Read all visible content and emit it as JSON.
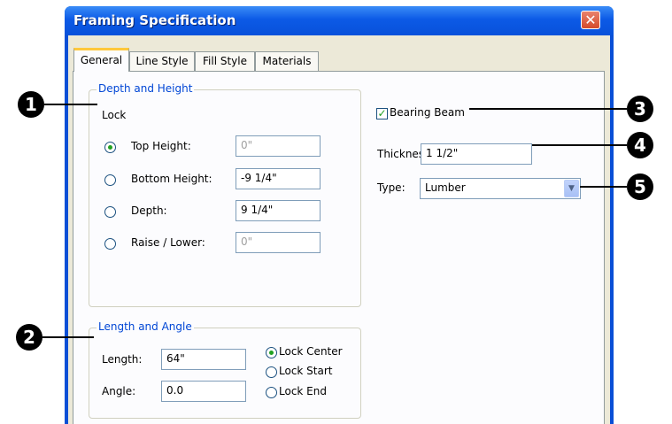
{
  "window": {
    "title": "Framing Specification",
    "close_glyph": "✕"
  },
  "tabs": [
    {
      "label": "General",
      "active": true
    },
    {
      "label": "Line Style",
      "active": false
    },
    {
      "label": "Fill Style",
      "active": false
    },
    {
      "label": "Materials",
      "active": false
    }
  ],
  "depth_height": {
    "legend": "Depth and Height",
    "lock_label": "Lock",
    "rows": [
      {
        "label": "Top Height:",
        "value": "0\"",
        "selected": true,
        "disabled": true
      },
      {
        "label": "Bottom Height:",
        "value": "-9 1/4\"",
        "selected": false,
        "disabled": false
      },
      {
        "label": "Depth:",
        "value": "9 1/4\"",
        "selected": false,
        "disabled": false
      },
      {
        "label": "Raise / Lower:",
        "value": "0\"",
        "selected": false,
        "disabled": true
      }
    ]
  },
  "length_angle": {
    "legend": "Length and Angle",
    "length_label": "Length:",
    "length_value": "64\"",
    "angle_label": "Angle:",
    "angle_value": "0.0",
    "lock_options": [
      {
        "label": "Lock Center",
        "selected": true
      },
      {
        "label": "Lock Start",
        "selected": false
      },
      {
        "label": "Lock End",
        "selected": false
      }
    ]
  },
  "beam": {
    "bearing_label": "Bearing Beam",
    "bearing_checked": true,
    "thickness_label": "Thickness:",
    "thickness_value": "1 1/2\"",
    "type_label": "Type:",
    "type_value": "Lumber",
    "check_glyph": "✓",
    "dropdown_glyph": "▼"
  },
  "callouts": [
    "1",
    "2",
    "3",
    "4",
    "5"
  ],
  "colors": {
    "titlebar": "#0A4FD6",
    "group_legend": "#0046D5",
    "dialog_bg": "#ECE9D8",
    "tab_highlight": "#FFC83C"
  }
}
